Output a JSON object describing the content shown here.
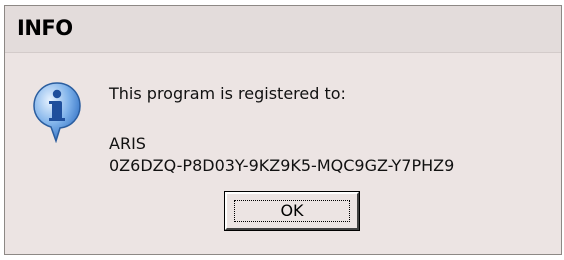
{
  "window": {
    "title": "INFO"
  },
  "message": {
    "line1": "This program is registered to:",
    "name": "ARIS",
    "key": "0Z6DZQ-P8D03Y-9KZ9K5-MQC9GZ-Y7PHZ9"
  },
  "buttons": {
    "ok_label": "OK"
  },
  "icon": {
    "name": "information-icon",
    "color": "#2f73c6"
  }
}
